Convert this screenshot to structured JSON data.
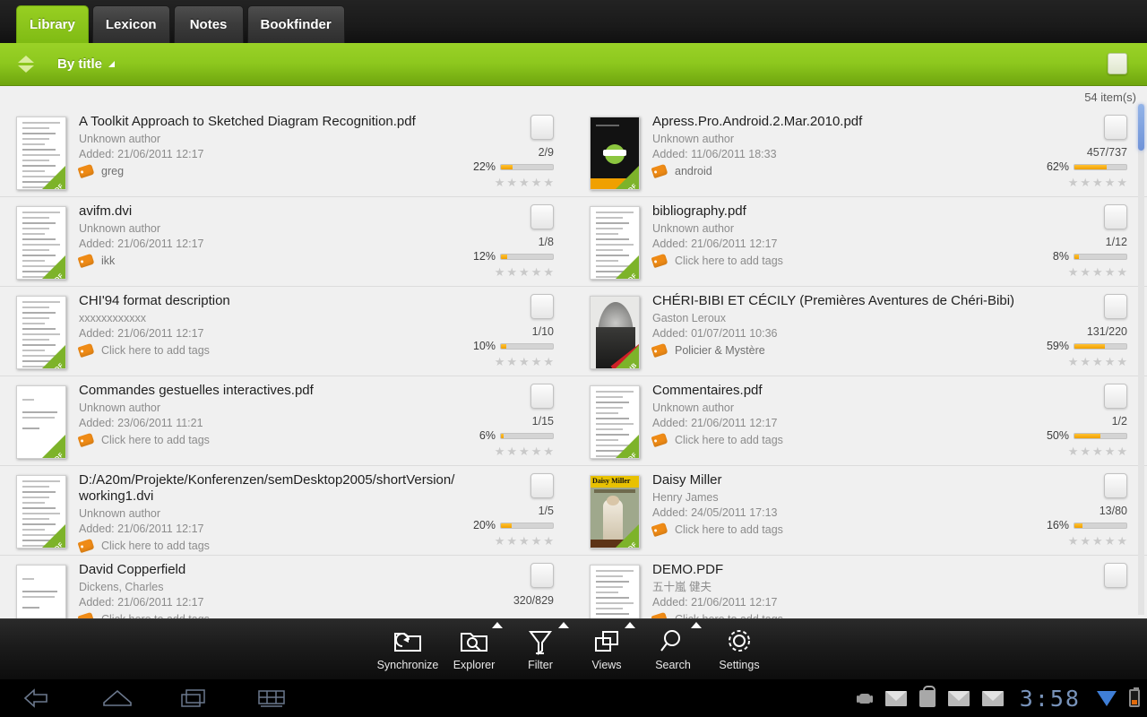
{
  "tabs": [
    {
      "label": "Library",
      "active": true
    },
    {
      "label": "Lexicon",
      "active": false
    },
    {
      "label": "Notes",
      "active": false
    },
    {
      "label": "Bookfinder",
      "active": false
    }
  ],
  "toolbar": {
    "sort_label": "By title",
    "sort_arrows_icon": "sort-updown-icon",
    "sort_caret_icon": "caret-icon",
    "view_toggle_icon": "view-toggle-icon"
  },
  "content": {
    "item_count": "54 item(s)"
  },
  "books": {
    "left": [
      {
        "title": "A Toolkit Approach to Sketched Diagram Recognition.pdf",
        "author": "Unknown author",
        "added": "Added: 21/06/2011 12:17",
        "tag": "greg",
        "tag_is_placeholder": false,
        "pages": "2/9",
        "percent": "22%",
        "percent_value": 22,
        "stars": 0,
        "format_badge": "PDF",
        "cover_type": "text-page"
      },
      {
        "title": "avifm.dvi",
        "author": "Unknown author",
        "added": "Added: 21/06/2011 12:17",
        "tag": "ikk",
        "tag_is_placeholder": false,
        "pages": "1/8",
        "percent": "12%",
        "percent_value": 12,
        "stars": 0,
        "format_badge": "PDF",
        "cover_type": "text-page"
      },
      {
        "title": "CHI'94 format description",
        "author": "xxxxxxxxxxxx",
        "added": "Added: 21/06/2011 12:17",
        "tag": "Click here to add tags",
        "tag_is_placeholder": true,
        "pages": "1/10",
        "percent": "10%",
        "percent_value": 10,
        "stars": 0,
        "format_badge": "PDF",
        "cover_type": "text-page"
      },
      {
        "title": "Commandes gestuelles interactives.pdf",
        "author": "Unknown author",
        "added": "Added: 23/06/2011 11:21",
        "tag": "Click here to add tags",
        "tag_is_placeholder": true,
        "pages": "1/15",
        "percent": "6%",
        "percent_value": 6,
        "stars": 0,
        "format_badge": "PDF",
        "cover_type": "sparse-page"
      },
      {
        "title": "D:/A20m/Projekte/Konferenzen/semDesktop2005/shortVersion/working1.dvi",
        "author": "Unknown author",
        "added": "Added: 21/06/2011 12:17",
        "tag": "Click here to add tags",
        "tag_is_placeholder": true,
        "pages": "1/5",
        "percent": "20%",
        "percent_value": 20,
        "stars": 0,
        "format_badge": "PDF",
        "cover_type": "text-page"
      },
      {
        "title": "David Copperfield",
        "author": "Dickens, Charles",
        "added": "Added: 21/06/2011 12:17",
        "tag": "Click here to add tags",
        "tag_is_placeholder": true,
        "pages": "320/829",
        "percent": "",
        "percent_value": 0,
        "stars": 0,
        "format_badge": "",
        "cover_type": "sparse-page"
      }
    ],
    "right": [
      {
        "title": "Apress.Pro.Android.2.Mar.2010.pdf",
        "author": "Unknown author",
        "added": "Added: 11/06/2011 18:33",
        "tag": "android",
        "tag_is_placeholder": false,
        "pages": "457/737",
        "percent": "62%",
        "percent_value": 62,
        "stars": 0,
        "format_badge": "PDF",
        "cover_type": "android-cover"
      },
      {
        "title": "bibliography.pdf",
        "author": "Unknown author",
        "added": "Added: 21/06/2011 12:17",
        "tag": "Click here to add tags",
        "tag_is_placeholder": true,
        "pages": "1/12",
        "percent": "8%",
        "percent_value": 8,
        "stars": 0,
        "format_badge": "PDF",
        "cover_type": "text-page"
      },
      {
        "title": "CHÉRI-BIBI ET CÉCILY (Premières Aventures de Chéri-Bibi)",
        "author": "Gaston Leroux",
        "added": "Added: 01/07/2011 10:36",
        "tag": "Policier & Mystère",
        "tag_is_placeholder": false,
        "pages": "131/220",
        "percent": "59%",
        "percent_value": 59,
        "stars": 0,
        "format_badge": "EPUB",
        "cover_type": "portrait-cover"
      },
      {
        "title": "Commentaires.pdf",
        "author": "Unknown author",
        "added": "Added: 21/06/2011 12:17",
        "tag": "Click here to add tags",
        "tag_is_placeholder": true,
        "pages": "1/2",
        "percent": "50%",
        "percent_value": 50,
        "stars": 0,
        "format_badge": "PDF",
        "cover_type": "text-page"
      },
      {
        "title": "Daisy Miller",
        "author": "Henry James",
        "added": "Added: 24/05/2011 17:13",
        "tag": "Click here to add tags",
        "tag_is_placeholder": true,
        "pages": "13/80",
        "percent": "16%",
        "percent_value": 16,
        "stars": 0,
        "format_badge": "PDF",
        "cover_type": "daisy-cover"
      },
      {
        "title": "DEMO.PDF",
        "author": "五十嵐 健夫",
        "added": "Added: 21/06/2011 12:17",
        "tag": "Click here to add tags",
        "tag_is_placeholder": true,
        "pages": "",
        "percent": "",
        "percent_value": 0,
        "stars": 0,
        "format_badge": "",
        "cover_type": "text-page"
      }
    ]
  },
  "apptoolbar": [
    {
      "label": "Synchronize",
      "icon": "synchronize-folder-icon",
      "has_flag": false
    },
    {
      "label": "Explorer",
      "icon": "explorer-folder-search-icon",
      "has_flag": true
    },
    {
      "label": "Filter",
      "icon": "filter-funnel-icon",
      "has_flag": true
    },
    {
      "label": "Views",
      "icon": "views-windows-icon",
      "has_flag": true
    },
    {
      "label": "Search",
      "icon": "search-magnifier-icon",
      "has_flag": true
    },
    {
      "label": "Settings",
      "icon": "settings-gear-icon",
      "has_flag": false
    }
  ],
  "systembar": {
    "nav": [
      {
        "icon": "back-icon"
      },
      {
        "icon": "home-icon"
      },
      {
        "icon": "recents-icon"
      },
      {
        "icon": "keyboard-icon"
      }
    ],
    "status_icons": [
      "android-notification-icon",
      "mail-icon",
      "market-bag-icon",
      "mail-icon",
      "mail-icon"
    ],
    "clock": "3:58",
    "wifi_icon": "wifi-icon",
    "battery_icon": "battery-icon"
  },
  "colors": {
    "accent_green": "#8dc81e",
    "progress_orange": "#f0a000",
    "tag_orange": "#ef8b16",
    "scrollbar_blue": "#6f93d8",
    "clock_blue": "#7f9bc4"
  }
}
